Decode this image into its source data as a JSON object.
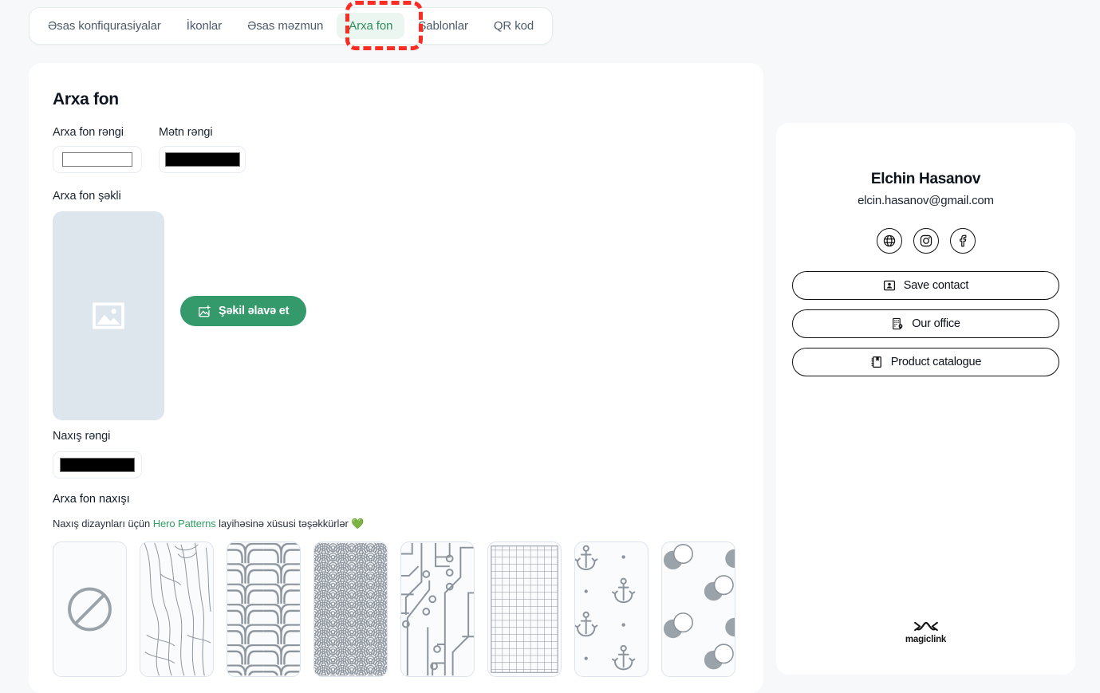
{
  "tabs": [
    {
      "label": "Əsas konfiqurasiyalar",
      "active": false
    },
    {
      "label": "İkonlar",
      "active": false
    },
    {
      "label": "Əsas məzmun",
      "active": false
    },
    {
      "label": "Arxa fon",
      "active": true
    },
    {
      "label": "Şablonlar",
      "active": false
    },
    {
      "label": "QR kod",
      "active": false
    }
  ],
  "annotation": {
    "color": "#fb2c24",
    "target": "Arxa fon"
  },
  "background_panel": {
    "title": "Arxa fon",
    "bg_color_label": "Arxa fon rəngi",
    "bg_color_value": "#ffffff",
    "text_color_label": "Mətn rəngi",
    "text_color_value": "#000000",
    "image_label": "Arxa fon şəkli",
    "image_placeholder_icon": "image-icon",
    "add_image_button": "Şəkil əlavə et",
    "add_image_icon": "add-image-icon",
    "pattern_color_label": "Naxış rəngi",
    "pattern_color_value": "#000000",
    "pattern_title": "Arxa fon naxışı",
    "pattern_credit_prefix": "Naxış dizaynları üçün ",
    "pattern_credit_link": "Hero Patterns",
    "pattern_credit_suffix": " layihəsinə xüsusi təşəkkürlər ",
    "pattern_credit_emoji": "💚"
  },
  "patterns": [
    {
      "name": "none",
      "icon": "circle-slash-icon",
      "selected": true
    },
    {
      "name": "topography",
      "icon": "topography-pattern",
      "selected": false
    },
    {
      "name": "chevron",
      "icon": "chevron-pattern",
      "selected": false
    },
    {
      "name": "seigaiha",
      "icon": "wave-pattern",
      "selected": false
    },
    {
      "name": "circuit",
      "icon": "circuit-board-pattern",
      "selected": false
    },
    {
      "name": "graph-paper",
      "icon": "grid-pattern",
      "selected": false
    },
    {
      "name": "anchors",
      "icon": "anchor-pattern",
      "selected": false
    },
    {
      "name": "bubbles",
      "icon": "bubbles-pattern",
      "selected": false
    }
  ],
  "preview": {
    "name": "Elchin Hasanov",
    "email": "elcin.hasanov@gmail.com",
    "socials": [
      {
        "name": "website",
        "icon": "globe-icon"
      },
      {
        "name": "instagram",
        "icon": "instagram-icon"
      },
      {
        "name": "facebook",
        "icon": "facebook-icon"
      }
    ],
    "actions": [
      {
        "label": "Save contact",
        "icon": "contact-card-icon"
      },
      {
        "label": "Our office",
        "icon": "building-location-icon"
      },
      {
        "label": "Product catalogue",
        "icon": "notebook-icon"
      }
    ],
    "brand": "magiclink",
    "brand_icon": "magiclink-logo"
  },
  "colors": {
    "page_bg": "#f7f8fa",
    "card_bg": "#ffffff",
    "accent_green": "#349a6c",
    "tab_active_bg": "#eaf6ef",
    "tab_active_text": "#2f8d5e",
    "annotation_red": "#fb2c24",
    "placeholder_bg": "#dde5ed",
    "pattern_stroke": "#8b939c"
  }
}
